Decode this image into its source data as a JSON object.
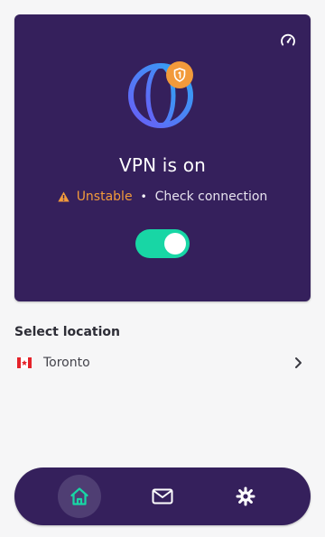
{
  "colors": {
    "card_bg": "#35205c",
    "accent_green": "#18d6a5",
    "warning_orange": "#f29a3b",
    "page_bg": "#f6f6f7"
  },
  "status": {
    "title": "VPN is on",
    "warning_label": "Unstable",
    "separator": "•",
    "hint": "Check connection",
    "toggle_on": true,
    "icons": {
      "speed": "speedometer-icon",
      "globe": "globe-icon",
      "shield": "shield-icon",
      "warning": "warning-icon"
    }
  },
  "location": {
    "heading": "Select location",
    "selected": "Toronto",
    "flag": "canada-flag-icon",
    "chevron": "chevron-right-icon"
  },
  "nav": {
    "items": [
      {
        "name": "home",
        "icon": "home-icon",
        "active": true
      },
      {
        "name": "messages",
        "icon": "mail-icon",
        "active": false
      },
      {
        "name": "settings",
        "icon": "gear-icon",
        "active": false
      }
    ]
  }
}
